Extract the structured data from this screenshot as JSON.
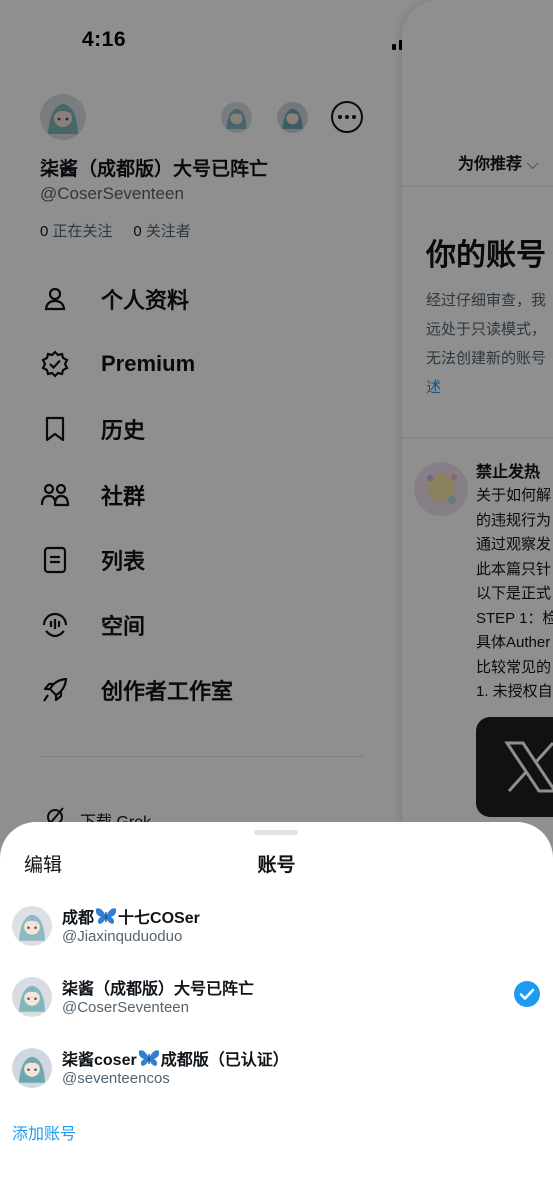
{
  "status_bar": {
    "time": "4:16"
  },
  "drawer": {
    "display_name": "柒酱（成都版）大号已阵亡",
    "handle": "@CoserSeventeen",
    "following_count": "0",
    "following_label": "正在关注",
    "followers_count": "0",
    "followers_label": "关注者",
    "menu": [
      {
        "label": "个人资料",
        "icon": "person-icon"
      },
      {
        "label": "Premium",
        "icon": "verified-badge-icon"
      },
      {
        "label": "历史",
        "icon": "bookmark-icon"
      },
      {
        "label": "社群",
        "icon": "people-icon"
      },
      {
        "label": "列表",
        "icon": "list-icon"
      },
      {
        "label": "空间",
        "icon": "spaces-mic-icon"
      },
      {
        "label": "创作者工作室",
        "icon": "rocket-icon"
      }
    ],
    "grok_label": "下载 Grok"
  },
  "timeline": {
    "tab_label": "为你推荐",
    "notice_title": "你的账号",
    "notice_lines": [
      "经过仔细审查，我",
      "远处于只读模式，",
      "无法创建新的账号"
    ],
    "notice_link": "述",
    "post_author": "禁止发热",
    "post_lines": [
      "关于如何解",
      "的违规行为",
      "通过观察发",
      "此本篇只针",
      "以下是正式",
      "STEP 1：检",
      "具体Auther",
      "比较常见的",
      "1. 未授权自"
    ]
  },
  "sheet": {
    "edit_label": "编辑",
    "title": "账号",
    "accounts": [
      {
        "name_before": "成都",
        "name_after": "十七COSer",
        "handle": "@Jiaxinquduoduo",
        "butterfly": true,
        "selected": false
      },
      {
        "name_before": "柒酱（成都版）大号已阵亡",
        "name_after": "",
        "handle": "@CoserSeventeen",
        "butterfly": false,
        "selected": true
      },
      {
        "name_before": "柒酱coser",
        "name_after": "成都版（已认证）",
        "handle": "@seventeencos",
        "butterfly": true,
        "selected": false
      }
    ],
    "add_account_label": "添加账号"
  },
  "colors": {
    "accent": "#1d9bf0",
    "text": "#0f1419",
    "muted": "#536471"
  }
}
